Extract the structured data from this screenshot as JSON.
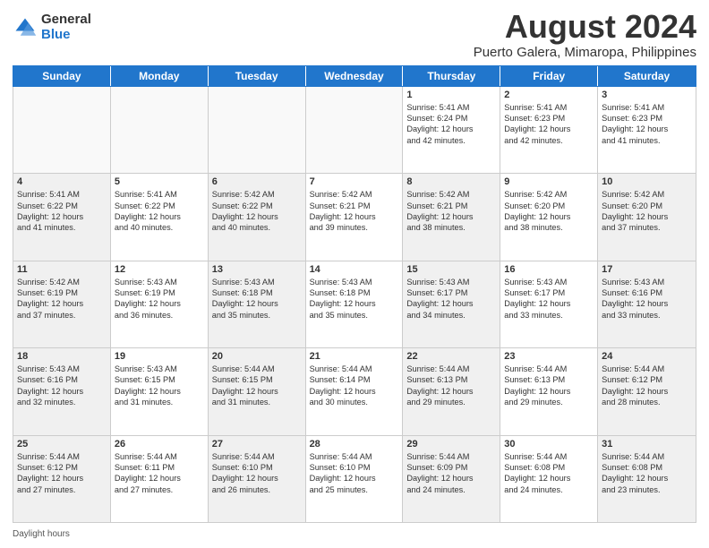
{
  "logo": {
    "general": "General",
    "blue": "Blue"
  },
  "title": "August 2024",
  "subtitle": "Puerto Galera, Mimaropa, Philippines",
  "days_of_week": [
    "Sunday",
    "Monday",
    "Tuesday",
    "Wednesday",
    "Thursday",
    "Friday",
    "Saturday"
  ],
  "footer": {
    "daylight_label": "Daylight hours"
  },
  "weeks": [
    [
      {
        "day": "",
        "info": "",
        "empty": true
      },
      {
        "day": "",
        "info": "",
        "empty": true
      },
      {
        "day": "",
        "info": "",
        "empty": true
      },
      {
        "day": "",
        "info": "",
        "empty": true
      },
      {
        "day": "1",
        "info": "Sunrise: 5:41 AM\nSunset: 6:24 PM\nDaylight: 12 hours\nand 42 minutes."
      },
      {
        "day": "2",
        "info": "Sunrise: 5:41 AM\nSunset: 6:23 PM\nDaylight: 12 hours\nand 42 minutes."
      },
      {
        "day": "3",
        "info": "Sunrise: 5:41 AM\nSunset: 6:23 PM\nDaylight: 12 hours\nand 41 minutes."
      }
    ],
    [
      {
        "day": "4",
        "info": "Sunrise: 5:41 AM\nSunset: 6:22 PM\nDaylight: 12 hours\nand 41 minutes.",
        "shaded": true
      },
      {
        "day": "5",
        "info": "Sunrise: 5:41 AM\nSunset: 6:22 PM\nDaylight: 12 hours\nand 40 minutes."
      },
      {
        "day": "6",
        "info": "Sunrise: 5:42 AM\nSunset: 6:22 PM\nDaylight: 12 hours\nand 40 minutes.",
        "shaded": true
      },
      {
        "day": "7",
        "info": "Sunrise: 5:42 AM\nSunset: 6:21 PM\nDaylight: 12 hours\nand 39 minutes."
      },
      {
        "day": "8",
        "info": "Sunrise: 5:42 AM\nSunset: 6:21 PM\nDaylight: 12 hours\nand 38 minutes.",
        "shaded": true
      },
      {
        "day": "9",
        "info": "Sunrise: 5:42 AM\nSunset: 6:20 PM\nDaylight: 12 hours\nand 38 minutes."
      },
      {
        "day": "10",
        "info": "Sunrise: 5:42 AM\nSunset: 6:20 PM\nDaylight: 12 hours\nand 37 minutes.",
        "shaded": true
      }
    ],
    [
      {
        "day": "11",
        "info": "Sunrise: 5:42 AM\nSunset: 6:19 PM\nDaylight: 12 hours\nand 37 minutes.",
        "shaded": true
      },
      {
        "day": "12",
        "info": "Sunrise: 5:43 AM\nSunset: 6:19 PM\nDaylight: 12 hours\nand 36 minutes."
      },
      {
        "day": "13",
        "info": "Sunrise: 5:43 AM\nSunset: 6:18 PM\nDaylight: 12 hours\nand 35 minutes.",
        "shaded": true
      },
      {
        "day": "14",
        "info": "Sunrise: 5:43 AM\nSunset: 6:18 PM\nDaylight: 12 hours\nand 35 minutes."
      },
      {
        "day": "15",
        "info": "Sunrise: 5:43 AM\nSunset: 6:17 PM\nDaylight: 12 hours\nand 34 minutes.",
        "shaded": true
      },
      {
        "day": "16",
        "info": "Sunrise: 5:43 AM\nSunset: 6:17 PM\nDaylight: 12 hours\nand 33 minutes."
      },
      {
        "day": "17",
        "info": "Sunrise: 5:43 AM\nSunset: 6:16 PM\nDaylight: 12 hours\nand 33 minutes.",
        "shaded": true
      }
    ],
    [
      {
        "day": "18",
        "info": "Sunrise: 5:43 AM\nSunset: 6:16 PM\nDaylight: 12 hours\nand 32 minutes.",
        "shaded": true
      },
      {
        "day": "19",
        "info": "Sunrise: 5:43 AM\nSunset: 6:15 PM\nDaylight: 12 hours\nand 31 minutes."
      },
      {
        "day": "20",
        "info": "Sunrise: 5:44 AM\nSunset: 6:15 PM\nDaylight: 12 hours\nand 31 minutes.",
        "shaded": true
      },
      {
        "day": "21",
        "info": "Sunrise: 5:44 AM\nSunset: 6:14 PM\nDaylight: 12 hours\nand 30 minutes."
      },
      {
        "day": "22",
        "info": "Sunrise: 5:44 AM\nSunset: 6:13 PM\nDaylight: 12 hours\nand 29 minutes.",
        "shaded": true
      },
      {
        "day": "23",
        "info": "Sunrise: 5:44 AM\nSunset: 6:13 PM\nDaylight: 12 hours\nand 29 minutes."
      },
      {
        "day": "24",
        "info": "Sunrise: 5:44 AM\nSunset: 6:12 PM\nDaylight: 12 hours\nand 28 minutes.",
        "shaded": true
      }
    ],
    [
      {
        "day": "25",
        "info": "Sunrise: 5:44 AM\nSunset: 6:12 PM\nDaylight: 12 hours\nand 27 minutes.",
        "shaded": true
      },
      {
        "day": "26",
        "info": "Sunrise: 5:44 AM\nSunset: 6:11 PM\nDaylight: 12 hours\nand 27 minutes."
      },
      {
        "day": "27",
        "info": "Sunrise: 5:44 AM\nSunset: 6:10 PM\nDaylight: 12 hours\nand 26 minutes.",
        "shaded": true
      },
      {
        "day": "28",
        "info": "Sunrise: 5:44 AM\nSunset: 6:10 PM\nDaylight: 12 hours\nand 25 minutes."
      },
      {
        "day": "29",
        "info": "Sunrise: 5:44 AM\nSunset: 6:09 PM\nDaylight: 12 hours\nand 24 minutes.",
        "shaded": true
      },
      {
        "day": "30",
        "info": "Sunrise: 5:44 AM\nSunset: 6:08 PM\nDaylight: 12 hours\nand 24 minutes."
      },
      {
        "day": "31",
        "info": "Sunrise: 5:44 AM\nSunset: 6:08 PM\nDaylight: 12 hours\nand 23 minutes.",
        "shaded": true
      }
    ]
  ]
}
